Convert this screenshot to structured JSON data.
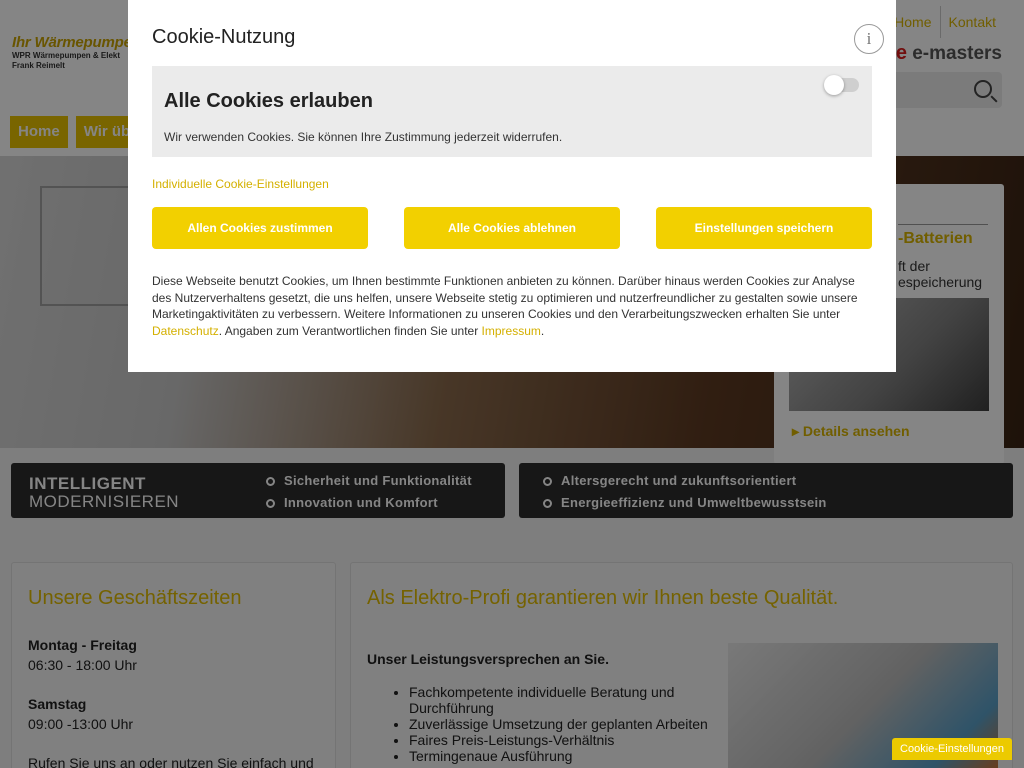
{
  "header": {
    "logo_title": "Ihr Wärmepumpen",
    "logo_sub1": "WPR Wärmepumpen & Elekt",
    "logo_sub2": "Frank Reimelt",
    "topnav": [
      "Home",
      "Kontakt"
    ],
    "emasters": "e-masters",
    "main_nav": [
      "Home",
      "Wir üb"
    ]
  },
  "hero_card": {
    "title": "-Batterien",
    "text_line1": "ft der",
    "text_line2": "espeicherung",
    "link": "Details ansehen"
  },
  "banners": {
    "left": {
      "big1": "INTELLIGENT",
      "big2": "MODERNISIEREN",
      "items": [
        "Sicherheit und Funktionalität",
        "Innovation und Komfort"
      ]
    },
    "right": {
      "items": [
        "Altersgerecht und zukunftsorientiert",
        "Energieeffizienz und Umweltbewusstsein"
      ]
    }
  },
  "hours": {
    "title": "Unsere Geschäftszeiten",
    "weekday_label": "Montag - Freitag",
    "weekday_time": "06:30 - 18:00 Uhr",
    "saturday_label": "Samstag",
    "saturday_time": "09:00 -13:00 Uhr",
    "cta": "Rufen Sie uns an oder nutzen Sie einfach und"
  },
  "quality": {
    "title": "Als Elektro-Profi garantieren wir Ihnen beste Qualität.",
    "promise": "Unser Leistungsversprechen an Sie.",
    "items": [
      "Fachkompetente individuelle Beratung und Durchführung",
      "Zuverlässige Umsetzung der geplanten Arbeiten",
      "Faires Preis-Leistungs-Verhältnis",
      "Termingenaue Ausführung"
    ]
  },
  "cookie_tab": "Cookie-Einstellungen",
  "modal": {
    "title": "Cookie-Nutzung",
    "info": "i",
    "allow_title": "Alle Cookies erlauben",
    "allow_desc": "Wir verwenden Cookies. Sie können Ihre Zustimmung jederzeit widerrufen.",
    "allow_toggle_on": false,
    "individual_link": "Individuelle Cookie-Einstellungen",
    "btn_accept": "Allen Cookies zustimmen",
    "btn_reject": "Alle Cookies ablehnen",
    "btn_save": "Einstellungen speichern",
    "text_before": "Diese Webseite benutzt Cookies, um Ihnen bestimmte Funktionen anbieten zu können. Darüber hinaus werden Cookies zur Analyse des Nutzerverhaltens gesetzt, die uns helfen, unsere Webseite stetig zu optimieren und nutzerfreundlicher zu gestalten sowie unsere Marketingaktivitäten zu verbessern. Weitere Informationen zu unseren Cookies und den Verarbeitungszwecken erhalten Sie unter ",
    "privacy_link": "Datenschutz",
    "text_middle": ". Angaben zum Verantwortlichen finden Sie unter ",
    "imprint_link": "Impressum",
    "text_end": "."
  },
  "colors": {
    "accent": "#f2d000",
    "overlay": "rgba(0,0,0,0.48)"
  }
}
